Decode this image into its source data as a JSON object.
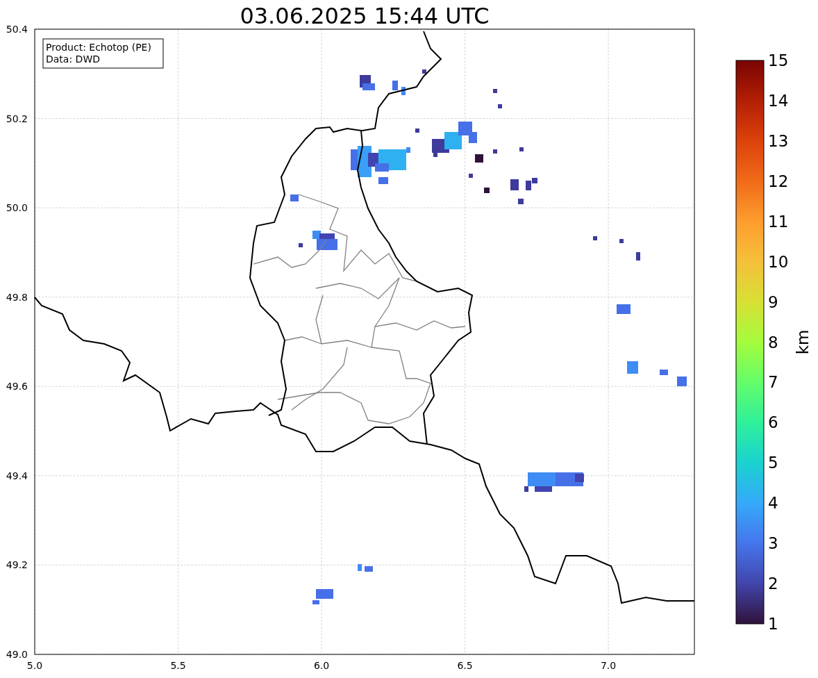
{
  "title": "03.06.2025 15:44 UTC",
  "legend": [
    "Product: Echotop (PE)",
    "Data: DWD"
  ],
  "x_ticks": [
    "5.0",
    "5.5",
    "6.0",
    "6.5",
    "7.0"
  ],
  "y_ticks": [
    "50.4",
    "50.2",
    "50.0",
    "49.8",
    "49.6",
    "49.4",
    "49.2",
    "49.0"
  ],
  "colorbar": {
    "label": "km",
    "ticks": [
      "15",
      "14",
      "13",
      "12",
      "11",
      "10",
      "9",
      "8",
      "7",
      "6",
      "5",
      "4",
      "3",
      "2",
      "1"
    ]
  }
}
